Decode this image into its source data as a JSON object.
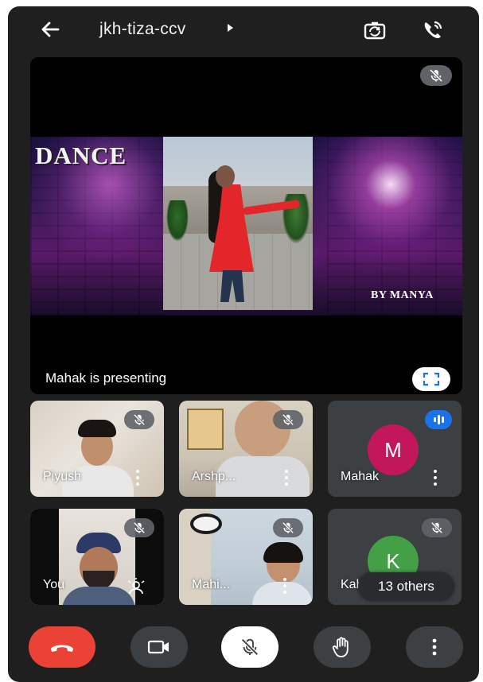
{
  "header": {
    "meeting_code": "jkh-tiza-ccv",
    "back_icon": "arrow-left-icon",
    "switch_camera_icon": "switch-camera-icon",
    "audio_output_icon": "phone-audio-icon"
  },
  "stage": {
    "slide_title": "DANCE",
    "slide_credit": "BY MANYA",
    "presenting_label": "Mahak is presenting",
    "mute_icon": "mic-off-icon",
    "fullscreen_icon": "fullscreen-icon"
  },
  "participants": [
    {
      "name": "Piyush",
      "muted": true
    },
    {
      "name": "Arshp...",
      "muted": true
    },
    {
      "name": "Mahak",
      "initial": "M",
      "avatar_color": "#c2185b",
      "speaking": true
    },
    {
      "name": "You",
      "muted": true
    },
    {
      "name": "Mahi...",
      "muted": true
    },
    {
      "name": "Kab",
      "initial": "K",
      "avatar_color": "#43a047",
      "muted": true
    }
  ],
  "others": {
    "label": "13 others"
  },
  "controls": {
    "end_call_icon": "end-call-icon",
    "camera_icon": "video-camera-icon",
    "mic_icon": "mic-off-icon",
    "raise_hand_icon": "raise-hand-icon",
    "more_icon": "more-vert-icon"
  },
  "colors": {
    "background": "#1f1f1f",
    "tile": "#3c4043",
    "end_call": "#ea4335",
    "speaking_badge": "#1a73e8"
  }
}
